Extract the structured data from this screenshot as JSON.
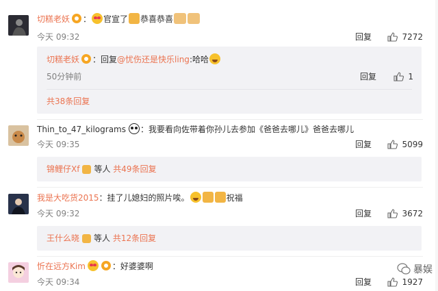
{
  "comments": [
    {
      "user": "切糕老妖",
      "text_before": "：",
      "text_a": "官宣了",
      "text_b": "恭喜恭喜",
      "time": "今天 09:32",
      "reply_label": "回复",
      "likes": "7272",
      "sub": {
        "user": "切糕老妖",
        "reply_prefix": "：回复",
        "mention": "@忧伤还是快乐ling",
        "reply_text": ":哈哈",
        "time": "50分钟前",
        "reply_label": "回复",
        "likes": "1",
        "more": "共38条回复"
      },
      "avatar_color": "#2b2b33"
    },
    {
      "user": "Thin_to_47_kilograms",
      "text": "：我要看向佐带着你孙儿去参加《爸爸去哪儿》爸爸去哪儿",
      "time": "今天 09:35",
      "reply_label": "回复",
      "likes": "5099",
      "sub_more": {
        "user": "锦鲤仔Xf",
        "others": "等人",
        "count": "共49条回复"
      },
      "avatar_color": "#c98a4a"
    },
    {
      "user": "我是大吃货2015",
      "text": "：挂了儿媳妇的照片唉。",
      "text_tail": "祝福",
      "time": "今天 09:32",
      "reply_label": "回复",
      "likes": "3672",
      "sub_more": {
        "user": "王什么晓",
        "others": "等人",
        "count": "共12条回复"
      },
      "avatar_color": "#28324a"
    },
    {
      "user": "忻在远方Kim",
      "text": "：好婆婆啊",
      "time": "今天 09:34",
      "reply_label": "回复",
      "likes": "1927",
      "avatar_color": "#f4cfe0"
    }
  ],
  "watermark": "暴娱",
  "colors": {
    "accent": "#eb7350",
    "sub_bg": "#f2f2f5",
    "meta": "#808080"
  }
}
